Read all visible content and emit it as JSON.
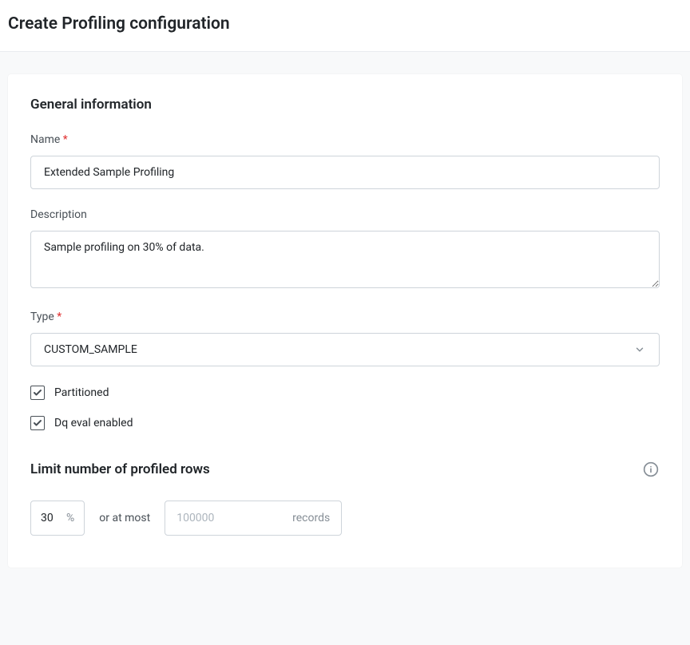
{
  "header": {
    "title": "Create Profiling configuration"
  },
  "general": {
    "section_title": "General information",
    "name_label": "Name",
    "name_value": "Extended Sample Profiling",
    "description_label": "Description",
    "description_value": "Sample profiling on 30% of data.",
    "type_label": "Type",
    "type_value": "CUSTOM_SAMPLE",
    "partitioned_label": "Partitioned",
    "partitioned_checked": true,
    "dq_eval_label": "Dq eval enabled",
    "dq_eval_checked": true
  },
  "limit": {
    "title": "Limit number of profiled rows",
    "percent_value": "30",
    "percent_unit": "%",
    "or_text": "or at most",
    "records_placeholder": "100000",
    "records_unit": "records"
  }
}
